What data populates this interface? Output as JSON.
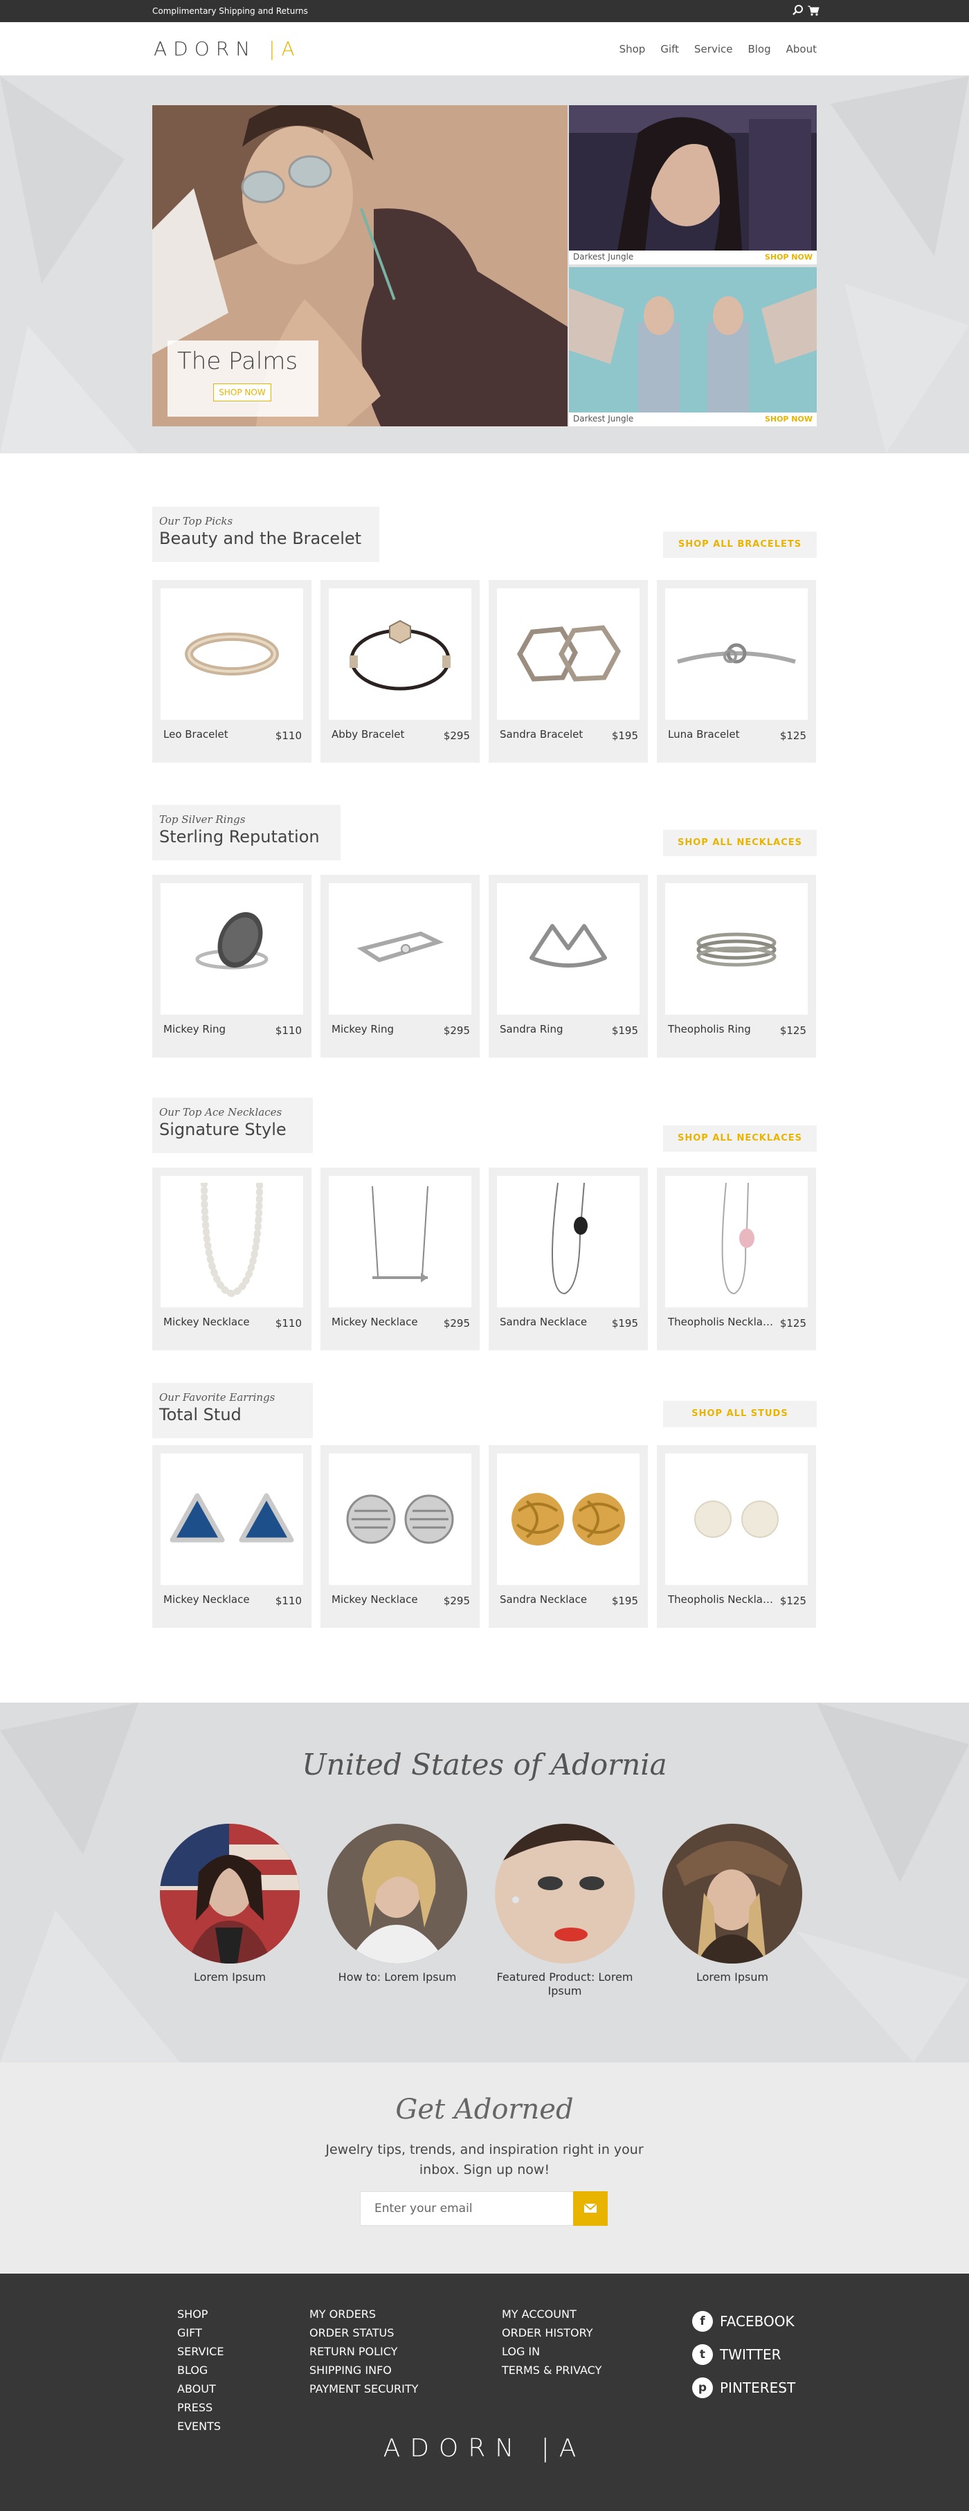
{
  "topbar": {
    "shipping": "Complimentary Shipping and Returns",
    "search_icon": "search-icon",
    "cart_icon": "cart-icon"
  },
  "brand": {
    "logo_left": "ADORN",
    "logo_bar": "|",
    "logo_right": "A",
    "accent": "#e8b400"
  },
  "nav": [
    "Shop",
    "Gift",
    "Service",
    "Blog",
    "About"
  ],
  "hero": {
    "main_title": "The Palms",
    "main_button": "SHOP NOW",
    "side": [
      {
        "name": "Darkest Jungle",
        "button": "SHOP NOW"
      },
      {
        "name": "Darkest Jungle",
        "button": "SHOP NOW"
      }
    ]
  },
  "sections": [
    {
      "sub": "Our Top Picks",
      "title": "Beauty and the Bracelet",
      "shop_all": "SHOP ALL BRACELETS",
      "items": [
        {
          "name": "Leo Bracelet",
          "price": "$110"
        },
        {
          "name": "Abby Bracelet",
          "price": "$295"
        },
        {
          "name": "Sandra Bracelet",
          "price": "$195"
        },
        {
          "name": "Luna Bracelet",
          "price": "$125"
        }
      ]
    },
    {
      "sub": "Top Silver Rings",
      "title": "Sterling Reputation",
      "shop_all": "SHOP ALL NECKLACES",
      "items": [
        {
          "name": "Mickey Ring",
          "price": "$110"
        },
        {
          "name": "Mickey Ring",
          "price": "$295"
        },
        {
          "name": "Sandra Ring",
          "price": "$195"
        },
        {
          "name": "Theopholis Ring",
          "price": "$125"
        }
      ]
    },
    {
      "sub": "Our Top Ace Necklaces",
      "title": "Signature Style",
      "shop_all": "SHOP ALL NECKLACES",
      "items": [
        {
          "name": "Mickey Necklace",
          "price": "$110"
        },
        {
          "name": "Mickey Necklace",
          "price": "$295"
        },
        {
          "name": "Sandra Necklace",
          "price": "$195"
        },
        {
          "name": "Theopholis Necklace",
          "price": "$125"
        }
      ]
    },
    {
      "sub": "Our Favorite Earrings",
      "title": "Total Stud",
      "shop_all": "SHOP ALL STUDS",
      "items": [
        {
          "name": "Mickey Necklace",
          "price": "$110"
        },
        {
          "name": "Mickey Necklace",
          "price": "$295"
        },
        {
          "name": "Sandra Necklace",
          "price": "$195"
        },
        {
          "name": "Theopholis Necklace",
          "price": "$125"
        }
      ]
    }
  ],
  "usa": {
    "title": "United States of Adornia",
    "people": [
      {
        "label": "Lorem Ipsum"
      },
      {
        "label": "How to: Lorem Ipsum"
      },
      {
        "label": "Featured Product: Lorem Ipsum"
      },
      {
        "label": "Lorem Ipsum"
      }
    ]
  },
  "newsletter": {
    "title": "Get Adorned",
    "text": "Jewelry tips, trends, and inspiration right in your inbox. Sign up now!",
    "placeholder": "Enter your email",
    "submit_icon": "envelope-icon"
  },
  "footer": {
    "col1": [
      "SHOP",
      "GIFT",
      "SERVICE",
      "BLOG",
      "ABOUT",
      "PRESS",
      "EVENTS"
    ],
    "col2": [
      "MY ORDERS",
      "ORDER STATUS",
      "RETURN POLICY",
      "SHIPPING INFO",
      "PAYMENT SECURITY"
    ],
    "col3": [
      "MY ACCOUNT",
      "ORDER HISTORY",
      "LOG IN",
      "TERMS & PRIVACY"
    ],
    "social": [
      {
        "label": "FACEBOOK",
        "icon": "facebook-icon",
        "glyph": "f"
      },
      {
        "label": "TWITTER",
        "icon": "twitter-icon",
        "glyph": "t"
      },
      {
        "label": "PINTEREST",
        "icon": "pinterest-icon",
        "glyph": "p"
      }
    ]
  }
}
